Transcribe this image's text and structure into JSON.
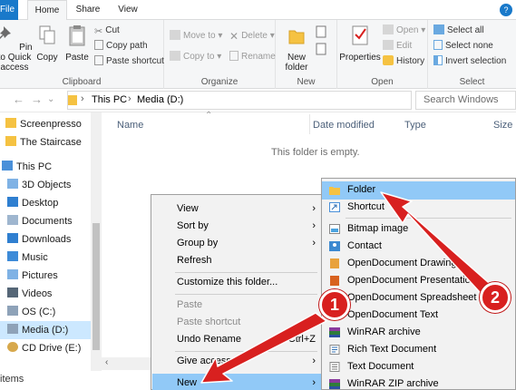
{
  "ribbon_tabs": {
    "file": "File",
    "home": "Home",
    "share": "Share",
    "view": "View"
  },
  "help_glyph": "?",
  "clipboard": {
    "pin": "Pin to Quick access",
    "copy": "Copy",
    "paste": "Paste",
    "cut": "Cut",
    "copy_path": "Copy path",
    "paste_shortcut": "Paste shortcut",
    "label": "Clipboard"
  },
  "organize": {
    "move_to": "Move to",
    "copy_to": "Copy to",
    "delete": "Delete",
    "rename": "Rename",
    "label": "Organize"
  },
  "new_group": {
    "new_folder": "New folder",
    "label": "New"
  },
  "open_group": {
    "properties": "Properties",
    "open": "Open",
    "edit": "Edit",
    "history": "History",
    "label": "Open"
  },
  "select_group": {
    "select_all": "Select all",
    "select_none": "Select none",
    "invert": "Invert selection",
    "label": "Select"
  },
  "address": {
    "part1": "This PC",
    "part2": "Media (D:)",
    "sep": "›"
  },
  "search": {
    "placeholder": "Search Windows"
  },
  "columns": {
    "name": "Name",
    "date": "Date modified",
    "type": "Type",
    "size": "Size"
  },
  "empty_message": "This folder is empty.",
  "nav": {
    "quick_items": [
      "Screenpresso",
      "The Staircase"
    ],
    "this_pc": "This PC",
    "items": [
      "3D Objects",
      "Desktop",
      "Documents",
      "Downloads",
      "Music",
      "Pictures",
      "Videos",
      "OS (C:)",
      "Media (D:)",
      "CD Drive (E:)"
    ]
  },
  "status": {
    "items": "items"
  },
  "context_menu": {
    "view": "View",
    "sort_by": "Sort by",
    "group_by": "Group by",
    "refresh": "Refresh",
    "customize": "Customize this folder...",
    "paste": "Paste",
    "paste_shortcut": "Paste shortcut",
    "undo_rename": "Undo Rename",
    "undo_shortcut": "Ctrl+Z",
    "give_access": "Give access to",
    "new": "New"
  },
  "new_submenu": [
    "Folder",
    "Shortcut",
    "Bitmap image",
    "Contact",
    "OpenDocument Drawing",
    "OpenDocument Presentation",
    "OpenDocument Spreadsheet",
    "OpenDocument Text",
    "WinRAR archive",
    "Rich Text Document",
    "Text Document",
    "WinRAR ZIP archive"
  ],
  "annotations": {
    "badge1": "1",
    "badge2": "2"
  },
  "colors": {
    "accent": "#1979ca",
    "highlight": "#91c9f7",
    "arrow": "#d8201f"
  }
}
